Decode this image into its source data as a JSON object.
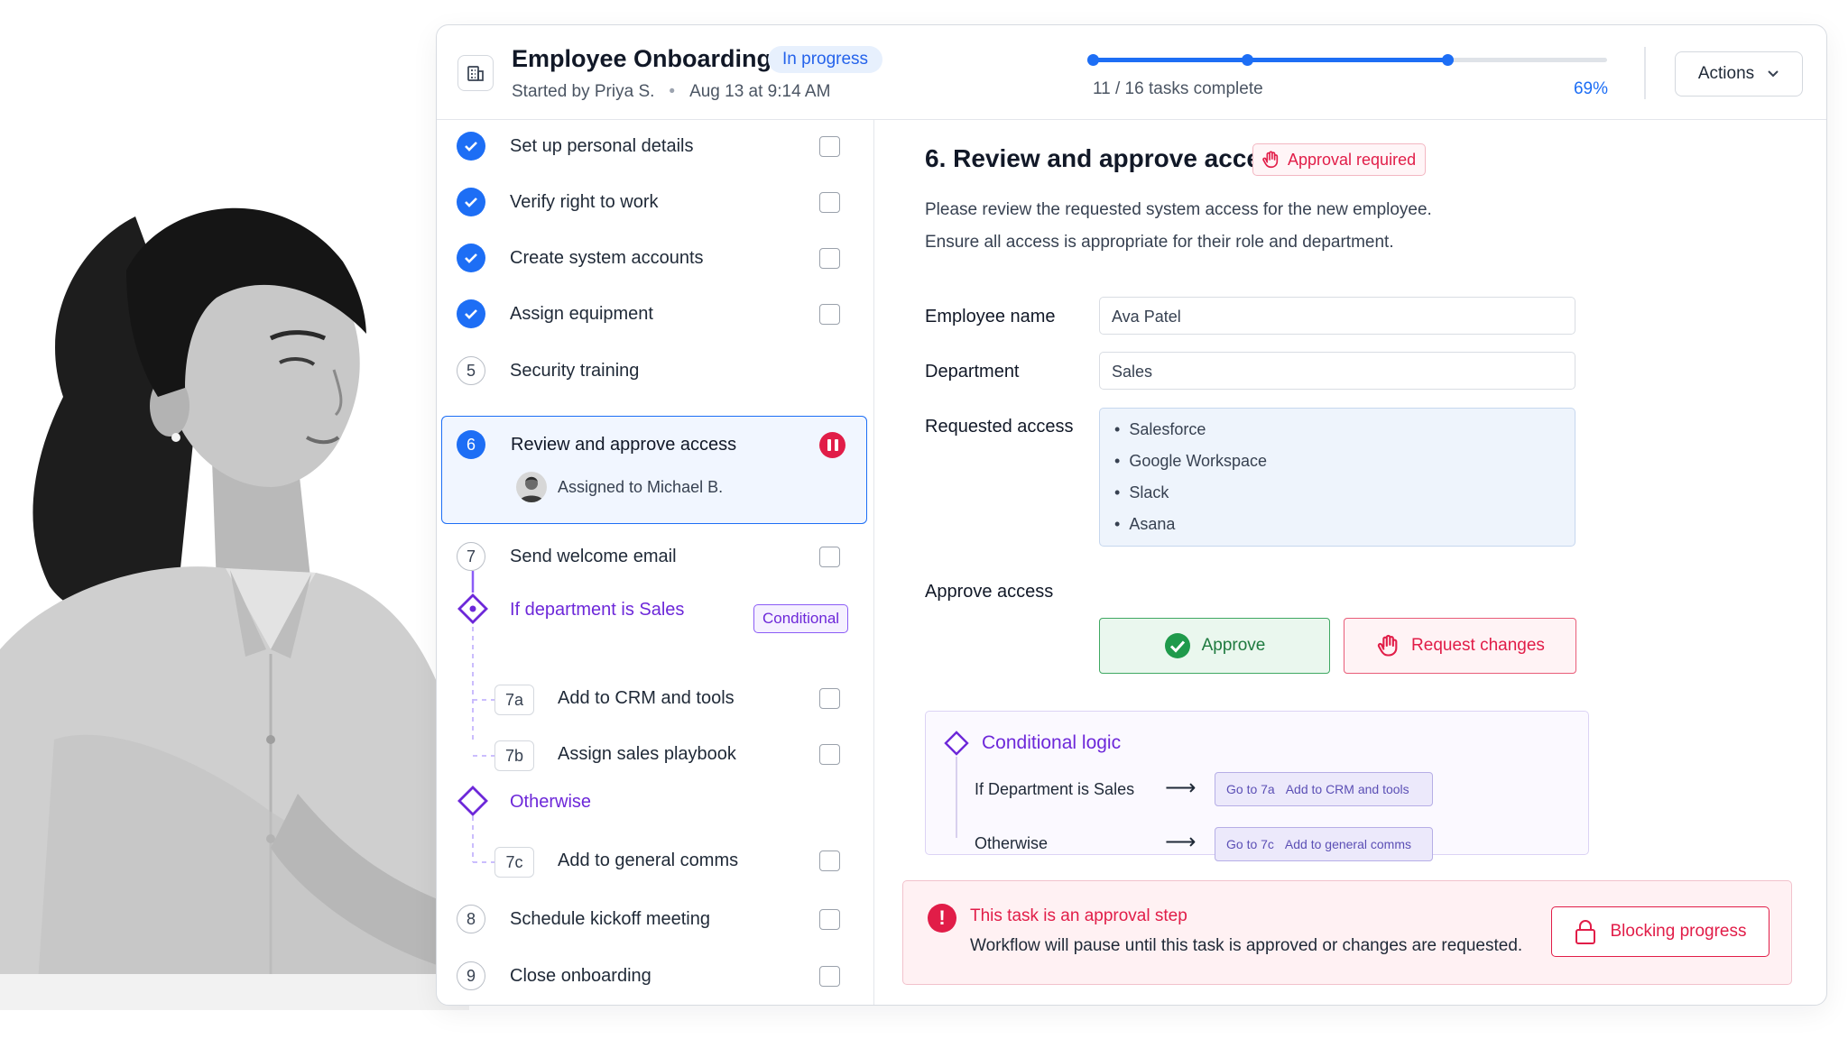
{
  "header": {
    "title": "Employee Onboarding",
    "status": "In progress",
    "started_by": "Started by Priya S.",
    "separator": "•",
    "started_at": "Aug 13 at 9:14 AM",
    "progress_text": "11 / 16 tasks complete",
    "progress_pct": "69%",
    "progress_fraction": 0.69,
    "actions_label": "Actions"
  },
  "tasks": [
    {
      "label": "Set up personal details",
      "status": "done"
    },
    {
      "label": "Verify right to work",
      "status": "done"
    },
    {
      "label": "Create system accounts",
      "status": "done"
    },
    {
      "label": "Assign equipment",
      "status": "done"
    },
    {
      "num": "5",
      "label": "Security training",
      "status": "pending"
    },
    {
      "num": "6",
      "label": "Review and approve access",
      "assignee": "Assigned to Michael B.",
      "status": "active"
    },
    {
      "num": "7",
      "label": "Send welcome email",
      "status": "pending"
    },
    {
      "num": "8",
      "label": "Schedule kickoff meeting",
      "status": "pending"
    },
    {
      "num": "9",
      "label": "Close onboarding",
      "status": "pending"
    }
  ],
  "condition": {
    "if_label": "If department is Sales",
    "badge": "Conditional",
    "otherwise_label": "Otherwise",
    "branch_sales": [
      {
        "tag": "7a",
        "label": "Add to CRM and tools"
      },
      {
        "tag": "7b",
        "label": "Assign sales playbook"
      }
    ],
    "branch_other": [
      {
        "tag": "7c",
        "label": "Add to general comms"
      }
    ]
  },
  "detail": {
    "title": "6. Review and approve access",
    "badge": "Approval required",
    "desc_line1": "Please review the requested system access for the new employee.",
    "desc_line2": "Ensure all access is appropriate for their role and department.",
    "employee_name_label": "Employee name",
    "employee_name_value": "Ava Patel",
    "department_label": "Department",
    "department_value": "Sales",
    "requested_access_label": "Requested access",
    "requested_access": [
      "Salesforce",
      "Google Workspace",
      "Slack",
      "Asana"
    ],
    "approve_access_label": "Approve access",
    "approve_button": "Approve",
    "request_changes_button": "Request changes"
  },
  "logic": {
    "title": "Conditional logic",
    "rules": [
      {
        "condition": "If Department is Sales",
        "arrow": "⟶",
        "go": "Go to 7a",
        "target": "Add to CRM and tools"
      },
      {
        "condition": "Otherwise",
        "arrow": "⟶",
        "go": "Go to 7c",
        "target": "Add to general comms"
      }
    ]
  },
  "alert": {
    "icon": "!",
    "title": "This task is an approval step",
    "text": "Workflow will pause until this task is approved or changes are requested.",
    "button": "Blocking progress"
  },
  "colors": {
    "accent": "#1d6ef5",
    "danger": "#e11d48",
    "success": "#3fa862",
    "conditional": "#6d28d9"
  }
}
